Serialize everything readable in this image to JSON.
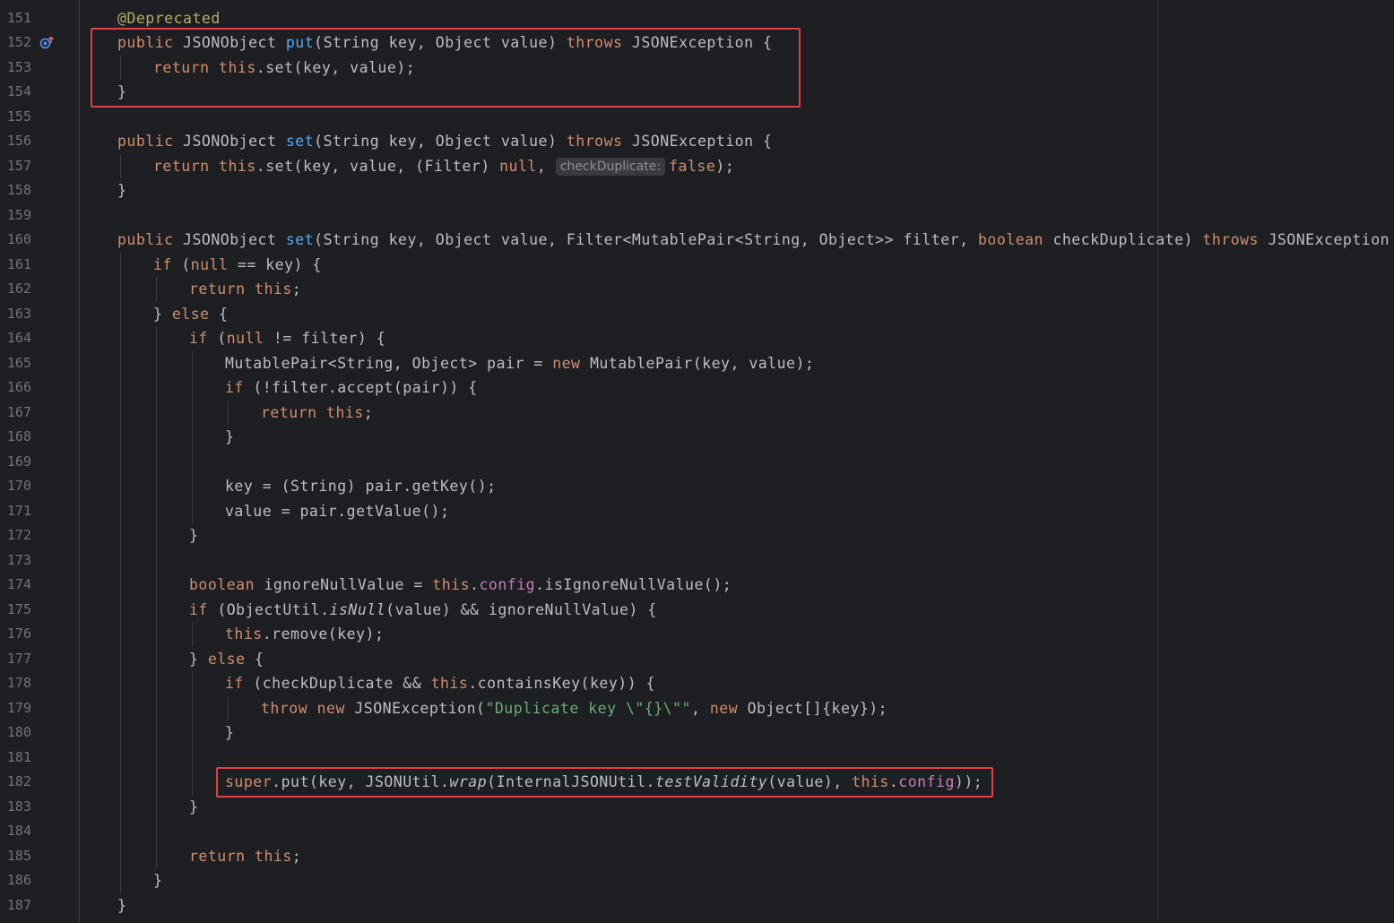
{
  "editor": {
    "lines": [
      {
        "n": "151",
        "indent": 1,
        "tokens": [
          {
            "t": "@Deprecated",
            "c": "an"
          }
        ]
      },
      {
        "n": "152",
        "indent": 1,
        "gutter_icon": "implementing-method-icon",
        "tokens": [
          {
            "t": "public ",
            "c": "kw"
          },
          {
            "t": "JSONObject "
          },
          {
            "t": "put",
            "c": "fn"
          },
          {
            "t": "(String key, Object value) "
          },
          {
            "t": "throws ",
            "c": "kw"
          },
          {
            "t": "JSONException {"
          }
        ]
      },
      {
        "n": "153",
        "indent": 2,
        "tokens": [
          {
            "t": "return ",
            "c": "kw"
          },
          {
            "t": "this",
            "c": "kw"
          },
          {
            "t": ".set(key, value);"
          }
        ]
      },
      {
        "n": "154",
        "indent": 1,
        "tokens": [
          {
            "t": "}"
          }
        ]
      },
      {
        "n": "155",
        "indent": 0,
        "tokens": []
      },
      {
        "n": "156",
        "indent": 1,
        "tokens": [
          {
            "t": "public ",
            "c": "kw"
          },
          {
            "t": "JSONObject "
          },
          {
            "t": "set",
            "c": "fn"
          },
          {
            "t": "(String key, Object value) "
          },
          {
            "t": "throws ",
            "c": "kw"
          },
          {
            "t": "JSONException {"
          }
        ]
      },
      {
        "n": "157",
        "indent": 2,
        "tokens": [
          {
            "t": "return ",
            "c": "kw"
          },
          {
            "t": "this",
            "c": "kw"
          },
          {
            "t": ".set(key, value, (Filter) "
          },
          {
            "t": "null",
            "c": "kw"
          },
          {
            "t": ", "
          },
          {
            "t": "checkDuplicate:",
            "c": "hint"
          },
          {
            "t": "false",
            "c": "kw"
          },
          {
            "t": ");"
          }
        ]
      },
      {
        "n": "158",
        "indent": 1,
        "tokens": [
          {
            "t": "}"
          }
        ]
      },
      {
        "n": "159",
        "indent": 0,
        "tokens": []
      },
      {
        "n": "160",
        "indent": 1,
        "tokens": [
          {
            "t": "public ",
            "c": "kw"
          },
          {
            "t": "JSONObject "
          },
          {
            "t": "set",
            "c": "fn"
          },
          {
            "t": "(String key, Object value, Filter<MutablePair<String, Object>> filter, "
          },
          {
            "t": "boolean ",
            "c": "kw"
          },
          {
            "t": "checkDuplicate) "
          },
          {
            "t": "throws ",
            "c": "kw"
          },
          {
            "t": "JSONException {"
          }
        ]
      },
      {
        "n": "161",
        "indent": 2,
        "tokens": [
          {
            "t": "if ",
            "c": "kw"
          },
          {
            "t": "("
          },
          {
            "t": "null ",
            "c": "kw"
          },
          {
            "t": "== key) {"
          }
        ]
      },
      {
        "n": "162",
        "indent": 3,
        "tokens": [
          {
            "t": "return ",
            "c": "kw"
          },
          {
            "t": "this",
            "c": "kw"
          },
          {
            "t": ";"
          }
        ]
      },
      {
        "n": "163",
        "indent": 2,
        "tokens": [
          {
            "t": "} "
          },
          {
            "t": "else ",
            "c": "kw"
          },
          {
            "t": "{"
          }
        ]
      },
      {
        "n": "164",
        "indent": 3,
        "tokens": [
          {
            "t": "if ",
            "c": "kw"
          },
          {
            "t": "("
          },
          {
            "t": "null ",
            "c": "kw"
          },
          {
            "t": "!= filter) {"
          }
        ]
      },
      {
        "n": "165",
        "indent": 4,
        "tokens": [
          {
            "t": "MutablePair<String, Object> pair = "
          },
          {
            "t": "new ",
            "c": "kw"
          },
          {
            "t": "MutablePair(key, value);"
          }
        ]
      },
      {
        "n": "166",
        "indent": 4,
        "tokens": [
          {
            "t": "if ",
            "c": "kw"
          },
          {
            "t": "(!filter.accept(pair)) {"
          }
        ]
      },
      {
        "n": "167",
        "indent": 5,
        "tokens": [
          {
            "t": "return ",
            "c": "kw"
          },
          {
            "t": "this",
            "c": "kw"
          },
          {
            "t": ";"
          }
        ]
      },
      {
        "n": "168",
        "indent": 4,
        "tokens": [
          {
            "t": "}"
          }
        ]
      },
      {
        "n": "169",
        "indent": 0,
        "tokens": []
      },
      {
        "n": "170",
        "indent": 4,
        "tokens": [
          {
            "t": "key = (String) pair.getKey();"
          }
        ]
      },
      {
        "n": "171",
        "indent": 4,
        "tokens": [
          {
            "t": "value = pair.getValue();"
          }
        ]
      },
      {
        "n": "172",
        "indent": 3,
        "tokens": [
          {
            "t": "}"
          }
        ]
      },
      {
        "n": "173",
        "indent": 0,
        "tokens": []
      },
      {
        "n": "174",
        "indent": 3,
        "tokens": [
          {
            "t": "boolean ",
            "c": "kw"
          },
          {
            "t": "ignoreNullValue = "
          },
          {
            "t": "this",
            "c": "kw"
          },
          {
            "t": "."
          },
          {
            "t": "config",
            "c": "fd"
          },
          {
            "t": ".isIgnoreNullValue();"
          }
        ]
      },
      {
        "n": "175",
        "indent": 3,
        "tokens": [
          {
            "t": "if ",
            "c": "kw"
          },
          {
            "t": "(ObjectUtil."
          },
          {
            "t": "isNull",
            "c": "it"
          },
          {
            "t": "(value) && ignoreNullValue) {"
          }
        ]
      },
      {
        "n": "176",
        "indent": 4,
        "tokens": [
          {
            "t": "this",
            "c": "kw"
          },
          {
            "t": ".remove(key);"
          }
        ]
      },
      {
        "n": "177",
        "indent": 3,
        "tokens": [
          {
            "t": "} "
          },
          {
            "t": "else ",
            "c": "kw"
          },
          {
            "t": "{"
          }
        ]
      },
      {
        "n": "178",
        "indent": 4,
        "tokens": [
          {
            "t": "if ",
            "c": "kw"
          },
          {
            "t": "(checkDuplicate && "
          },
          {
            "t": "this",
            "c": "kw"
          },
          {
            "t": ".containsKey(key)) {"
          }
        ]
      },
      {
        "n": "179",
        "indent": 5,
        "tokens": [
          {
            "t": "throw ",
            "c": "kw"
          },
          {
            "t": "new ",
            "c": "kw"
          },
          {
            "t": "JSONException("
          },
          {
            "t": "\"Duplicate key \\\"{}\\\"\"",
            "c": "st"
          },
          {
            "t": ", "
          },
          {
            "t": "new ",
            "c": "kw"
          },
          {
            "t": "Object[]{key});"
          }
        ]
      },
      {
        "n": "180",
        "indent": 4,
        "tokens": [
          {
            "t": "}"
          }
        ]
      },
      {
        "n": "181",
        "indent": 0,
        "tokens": []
      },
      {
        "n": "182",
        "indent": 4,
        "tokens": [
          {
            "t": "super",
            "c": "kw"
          },
          {
            "t": ".put(key, JSONUtil."
          },
          {
            "t": "wrap",
            "c": "it"
          },
          {
            "t": "(InternalJSONUtil."
          },
          {
            "t": "testValidity",
            "c": "it"
          },
          {
            "t": "(value), "
          },
          {
            "t": "this",
            "c": "kw"
          },
          {
            "t": "."
          },
          {
            "t": "config",
            "c": "fd"
          },
          {
            "t": "));"
          }
        ]
      },
      {
        "n": "183",
        "indent": 3,
        "tokens": [
          {
            "t": "}"
          }
        ]
      },
      {
        "n": "184",
        "indent": 0,
        "tokens": []
      },
      {
        "n": "185",
        "indent": 3,
        "tokens": [
          {
            "t": "return ",
            "c": "kw"
          },
          {
            "t": "this",
            "c": "kw"
          },
          {
            "t": ";"
          }
        ]
      },
      {
        "n": "186",
        "indent": 2,
        "tokens": [
          {
            "t": "}"
          }
        ]
      },
      {
        "n": "187",
        "indent": 1,
        "tokens": [
          {
            "t": "}"
          }
        ]
      }
    ],
    "highlights": [
      {
        "name": "put-method-highlight",
        "from_line": "152",
        "to_line": "154"
      },
      {
        "name": "super-put-highlight",
        "from_line": "182",
        "to_line": "182"
      }
    ],
    "colors": {
      "background": "#1e1f22",
      "keyword": "#cf8e6d",
      "method_declaration": "#56a8f5",
      "annotation": "#b3ae60",
      "string": "#6aab73",
      "field": "#c77dbb",
      "highlight_box": "#e0403f"
    }
  }
}
